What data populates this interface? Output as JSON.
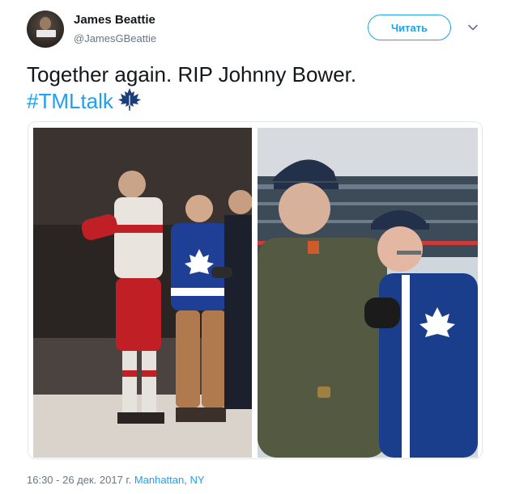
{
  "user": {
    "name": "James Beattie",
    "handle": "@JamesGBeattie"
  },
  "follow_button": {
    "label": "Читать"
  },
  "tweet": {
    "line1": "Together again. RIP Johnny Bower.",
    "hashtag": "#TMLtalk"
  },
  "meta": {
    "timestamp": "16:30 - 26 дек. 2017 г.",
    "location": "Manhattan, NY"
  },
  "colors": {
    "accent": "#1da1f2",
    "secondary_text": "#657786",
    "primary_text": "#14171a"
  },
  "icons": [
    "avatar",
    "maple-leaf-icon",
    "chevron-down-icon"
  ]
}
